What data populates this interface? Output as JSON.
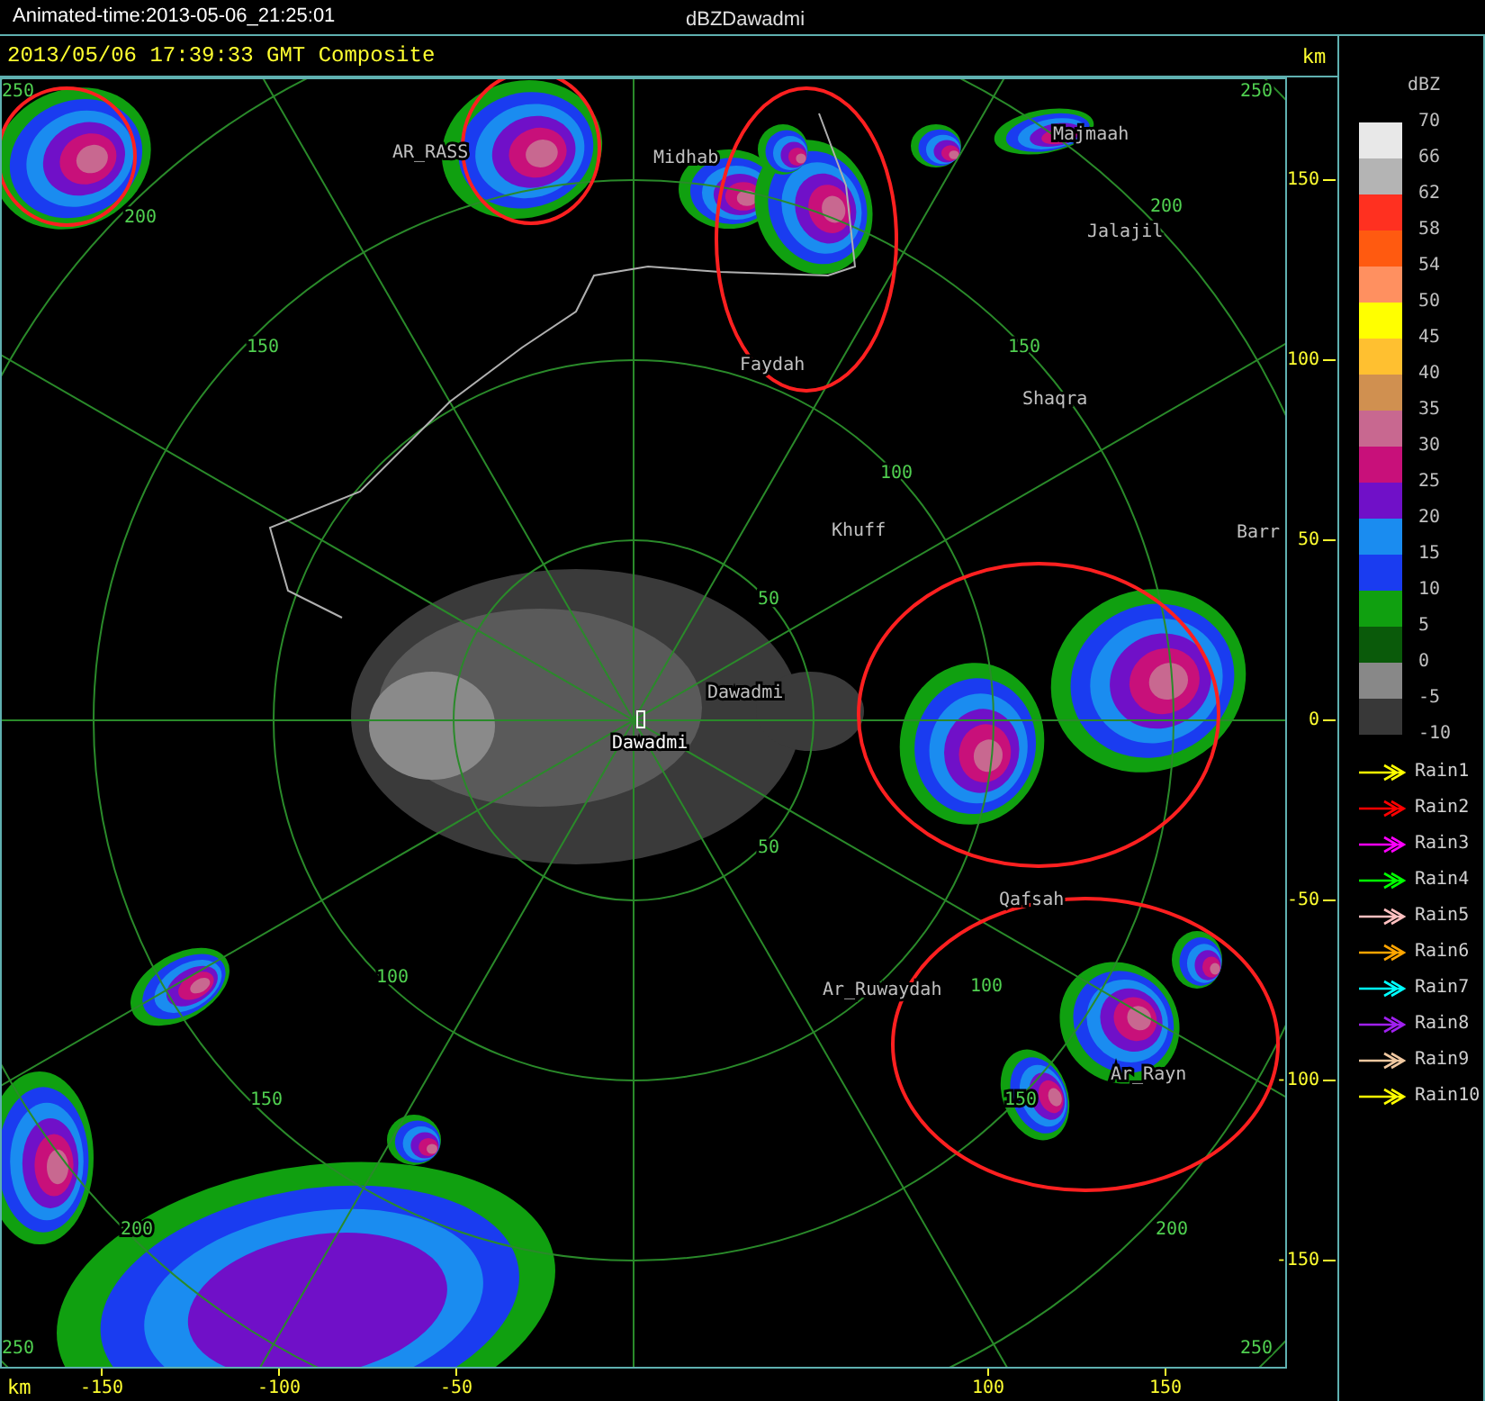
{
  "window": {
    "title": "Animated-time:2013-05-06_21:25:01",
    "product": "dBZDawadmi"
  },
  "subtitle": "2013/05/06 17:39:33 GMT Composite",
  "places": [
    {
      "name": "AR_RASS"
    },
    {
      "name": "Midhab"
    },
    {
      "name": "Majmaah"
    },
    {
      "name": "Jalajil"
    },
    {
      "name": "Faydah"
    },
    {
      "name": "Shaqra"
    },
    {
      "name": "Khuff"
    },
    {
      "name": "Barr"
    },
    {
      "name": "Dawadmi"
    },
    {
      "name": "Dawadmi",
      "kind": "radar"
    },
    {
      "name": "Qafsah"
    },
    {
      "name": "Ar_Ruwaydah"
    },
    {
      "name": "Ar_Rayn"
    }
  ],
  "ring_labels": [
    "250",
    "250",
    "200",
    "200",
    "150",
    "150",
    "100",
    "50",
    "50",
    "100",
    "100",
    "150",
    "150",
    "200",
    "200",
    "250",
    "250"
  ],
  "y_axis": {
    "unit": "km",
    "ticks": [
      "150",
      "100",
      "50",
      "0",
      "-50",
      "-100",
      "-150"
    ]
  },
  "x_axis": {
    "unit": "km",
    "ticks": [
      "-150",
      "-100",
      "-50",
      "100",
      "150"
    ]
  },
  "legend": {
    "title": "dBZ",
    "levels": [
      "70",
      "66",
      "62",
      "58",
      "54",
      "50",
      "45",
      "40",
      "35",
      "30",
      "25",
      "20",
      "15",
      "10",
      "5",
      "0",
      "-5",
      "-10"
    ],
    "bands": [
      {
        "color": "#e8e8e8"
      },
      {
        "color": "#b4b4b4"
      },
      {
        "color": "#ff3020"
      },
      {
        "color": "#ff5a10"
      },
      {
        "color": "#ff9060"
      },
      {
        "color": "#ffff00"
      },
      {
        "color": "#ffc030"
      },
      {
        "color": "#d09050"
      },
      {
        "color": "#c86890"
      },
      {
        "color": "#c8107a"
      },
      {
        "color": "#7010c8"
      },
      {
        "color": "#1a8cf0"
      },
      {
        "color": "#1a3cf0"
      },
      {
        "color": "#10a010"
      },
      {
        "color": "#0a5a0a"
      },
      {
        "color": "#888888"
      },
      {
        "color": "#383838"
      }
    ]
  },
  "tracks": [
    {
      "label": "Rain1",
      "color": "#ffff00"
    },
    {
      "label": "Rain2",
      "color": "#ff0000"
    },
    {
      "label": "Rain3",
      "color": "#ff00ff"
    },
    {
      "label": "Rain4",
      "color": "#00ff00"
    },
    {
      "label": "Rain5",
      "color": "#ffc0c0"
    },
    {
      "label": "Rain6",
      "color": "#ffa500"
    },
    {
      "label": "Rain7",
      "color": "#00ffff"
    },
    {
      "label": "Rain8",
      "color": "#a020f0"
    },
    {
      "label": "Rain9",
      "color": "#f0c8a0"
    },
    {
      "label": "Rain10",
      "color": "#ffff00"
    }
  ]
}
